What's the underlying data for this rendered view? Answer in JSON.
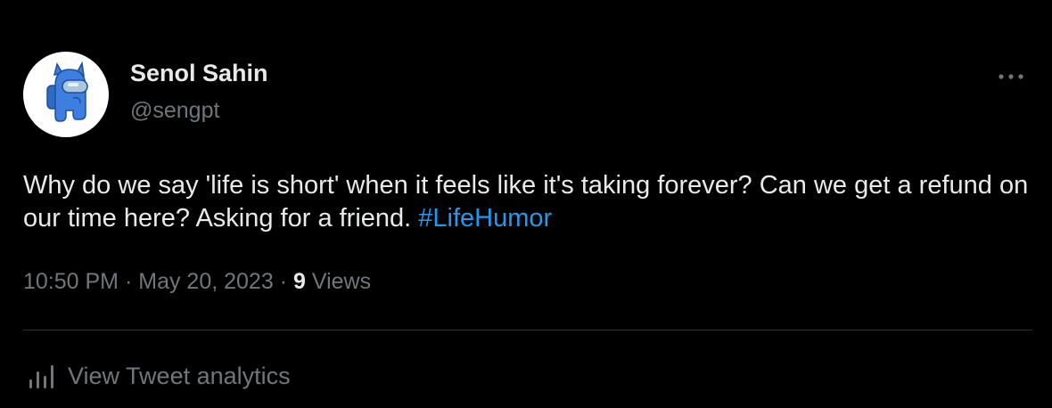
{
  "tweet": {
    "author": {
      "display_name": "Senol Sahin",
      "handle": "@sengpt",
      "avatar_icon": "blue-crewmate-avatar"
    },
    "more_icon": "more-dots-icon",
    "text_before_hashtag": "Why do we say 'life is short' when it feels like it's taking forever? Can we get a refund on our time here? Asking for a friend. ",
    "hashtag": "#LifeHumor",
    "time": "10:50 PM",
    "separator": "·",
    "date": "May 20, 2023",
    "views_count": "9",
    "views_label": "Views",
    "analytics": {
      "icon": "bar-chart-icon",
      "label": "View Tweet analytics"
    }
  },
  "colors": {
    "background": "#000000",
    "text_primary": "#e7e9ea",
    "text_secondary": "#71767b",
    "link": "#1d9bf0",
    "divider": "#2f3336",
    "avatar_bg": "#ffffff",
    "crewmate_blue": "#3d7fe0"
  }
}
